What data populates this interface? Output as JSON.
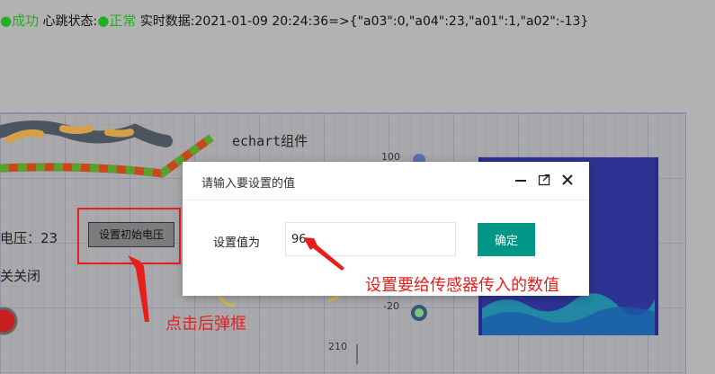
{
  "status": {
    "conn_indicator": "●成功",
    "heartbeat_label": "心跳状态:",
    "heartbeat_value": "●正常",
    "realtime_label": "实时数据:2021-01-09 20:24:36=>{\"a03\":0,\"a04\":23,\"a01\":1,\"a02\":-13}"
  },
  "canvas": {
    "echart_label": "echart组件",
    "voltage_label": "电压：23",
    "init_button_label": "设置初始电压",
    "switch_label": "关关闭",
    "gauge_tick_top": "100",
    "gauge_tick_bottom": "-20",
    "axis_tick": "210"
  },
  "annotations": {
    "click_popup": "点击后弹框",
    "set_value_hint": "设置要给传感器传入的数值"
  },
  "modal": {
    "title": "请输入要设置的值",
    "field_label": "设置值为",
    "input_value": "96",
    "confirm_label": "确定"
  },
  "colors": {
    "success_green": "#1fb11f",
    "annotation_red": "#e61e1e",
    "confirm_teal": "#009688"
  }
}
